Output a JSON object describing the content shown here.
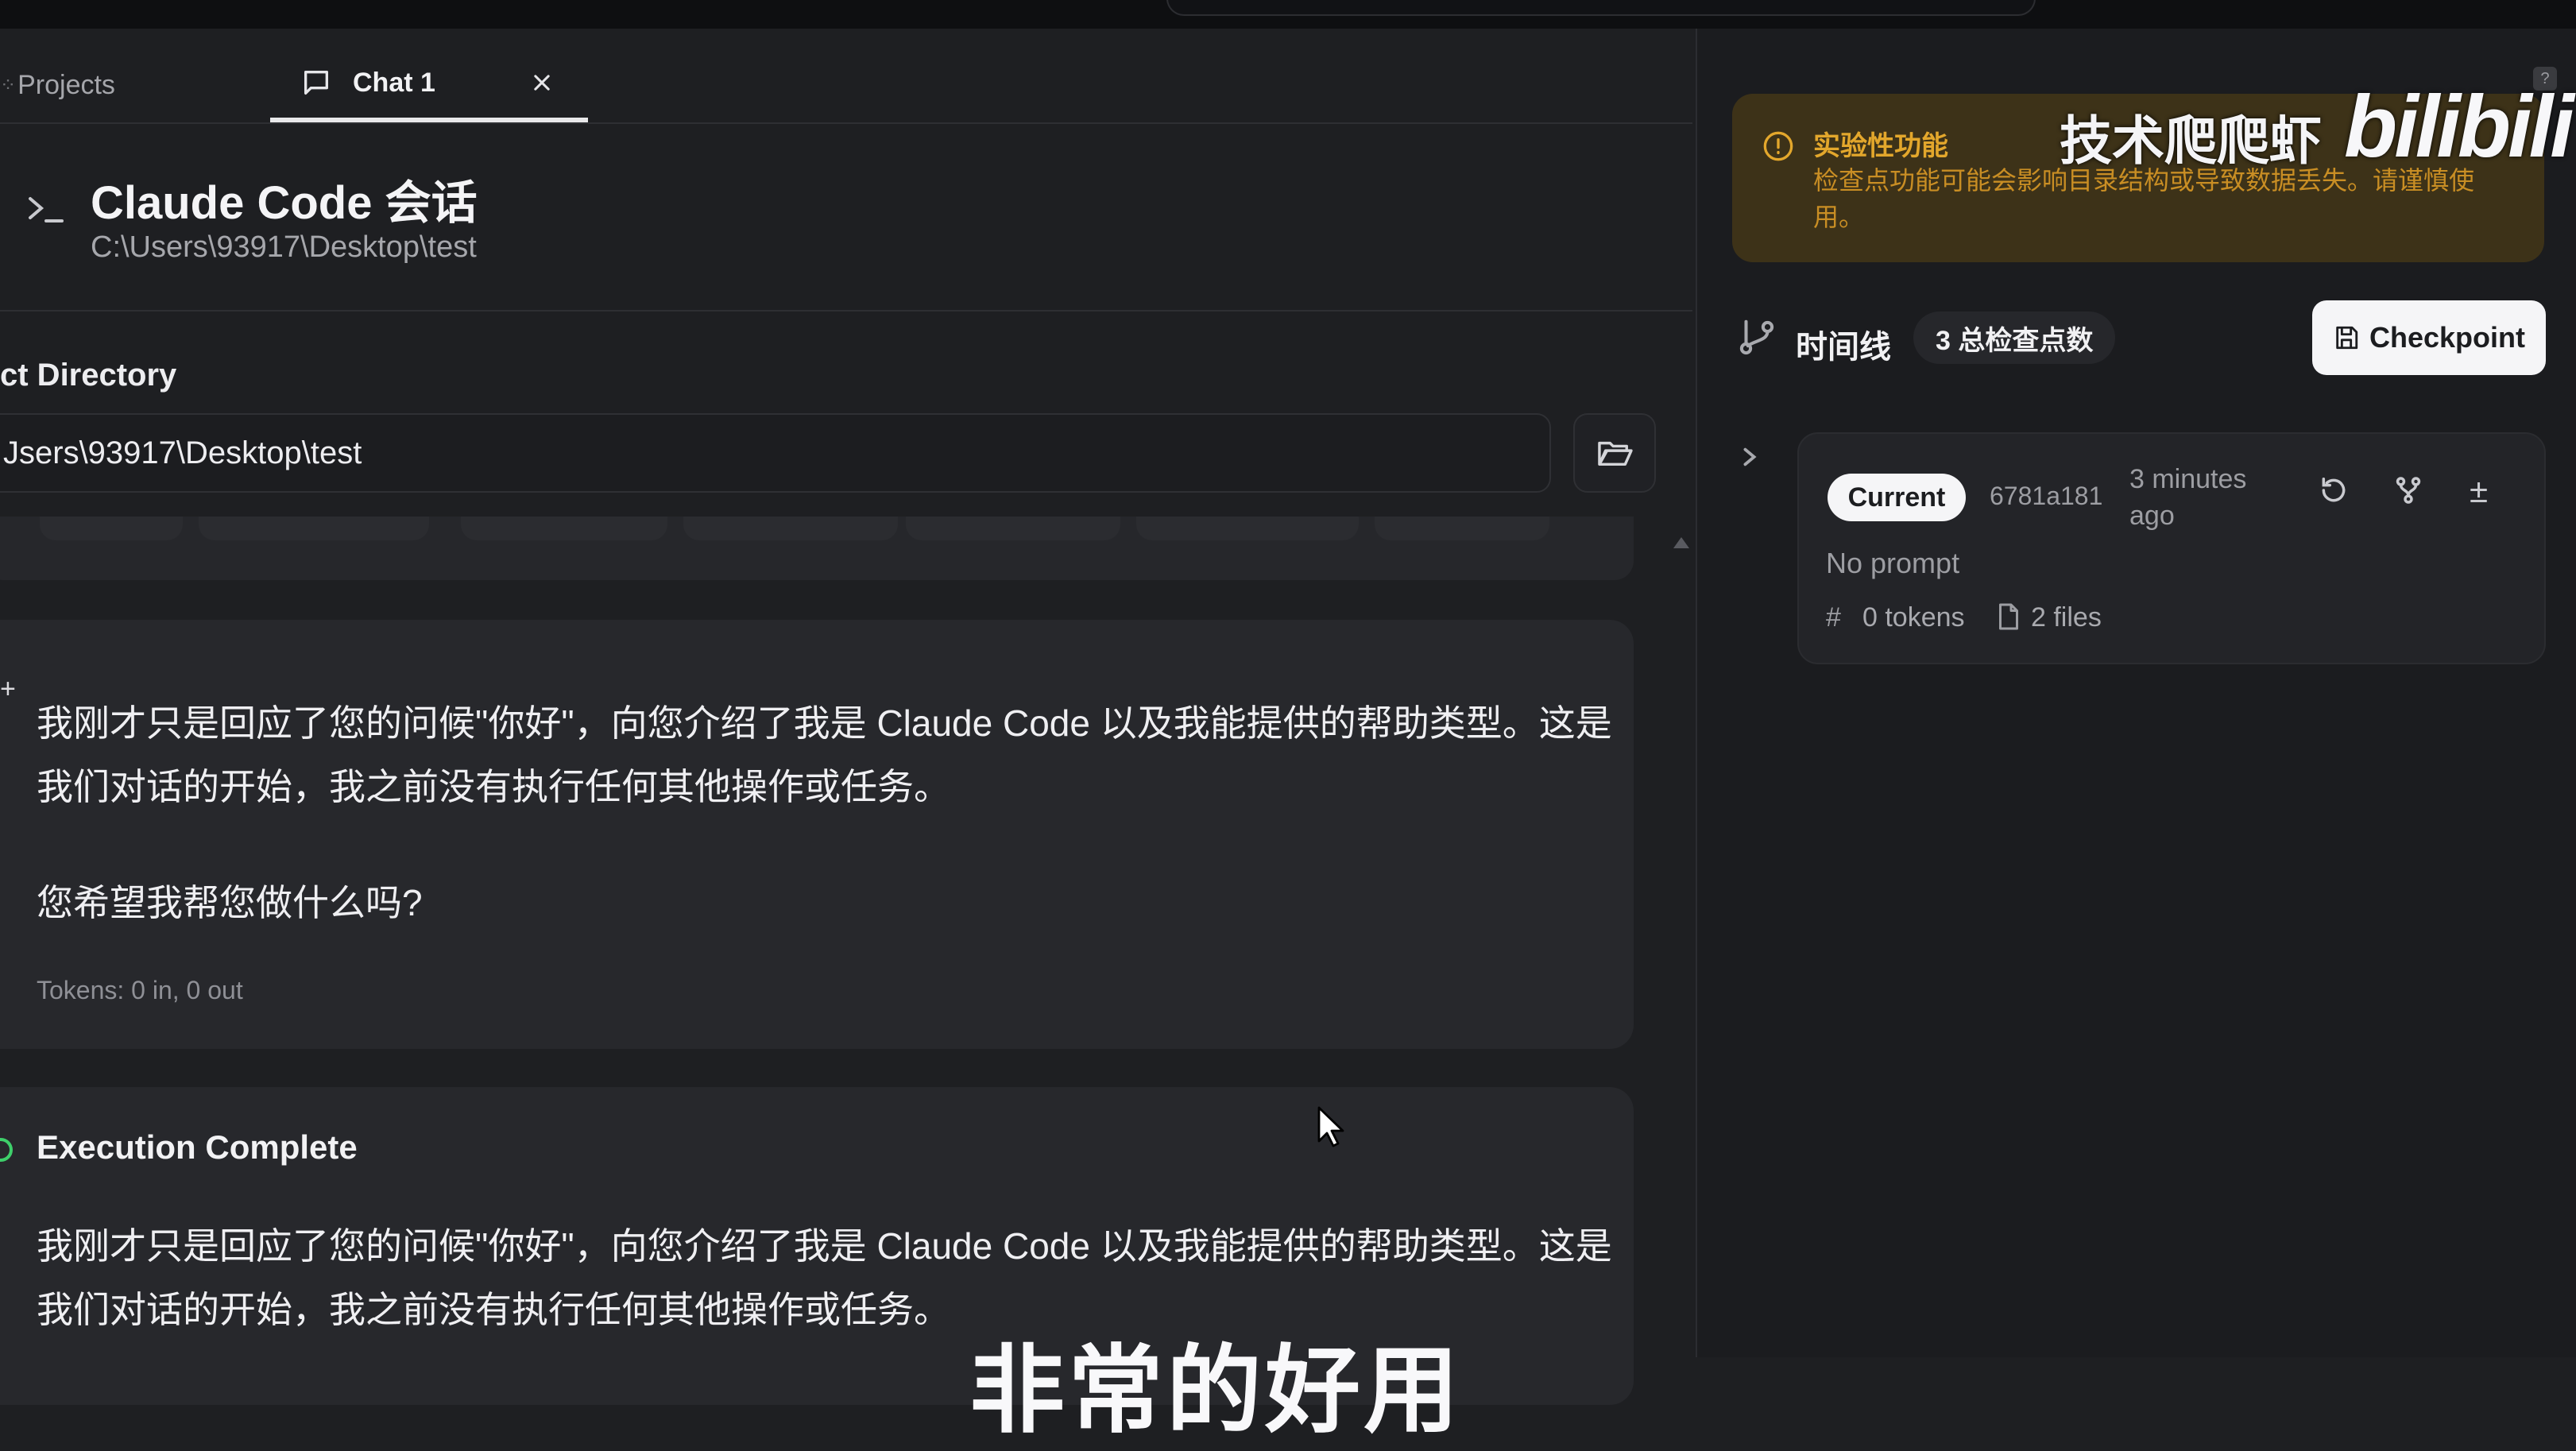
{
  "tabs": {
    "projects_label": "Projects",
    "projects_icon": "projects-icon",
    "chat_label": "Chat 1",
    "chat_icon": "message-square-icon",
    "close_icon": "close-icon"
  },
  "session": {
    "title": "Claude Code 会话",
    "path": "C:\\Users\\93917\\Desktop\\test"
  },
  "directory": {
    "label": "ct Directory",
    "value": "Jsers\\93917\\Desktop\\test"
  },
  "messages": [
    {
      "marker": "+",
      "paragraph1": "我刚才只是回应了您的问候\"你好\"，向您介绍了我是 Claude Code 以及我能提供的帮助类型。这是我们对话的开始，我之前没有执行任何其他操作或任务。",
      "paragraph2": "您希望我帮您做什么吗?",
      "tokens": "Tokens: 0 in, 0 out"
    },
    {
      "title": "Execution Complete",
      "paragraph1": "我刚才只是回应了您的问候\"你好\"，向您介绍了我是 Claude Code 以及我能提供的帮助类型。这是我们对话的开始，我之前没有执行任何其他操作或任务。"
    }
  ],
  "video_subtitle": "非常的好用",
  "warning": {
    "title": "实验性功能",
    "text": "检查点功能可能会影响目录结构或导致数据丢失。请谨慎使用。"
  },
  "watermark": {
    "text": "技术爬爬虾",
    "logo": "bilibili"
  },
  "timeline": {
    "label": "时间线",
    "count_badge": "3 总检查点数",
    "checkpoint_button": "Checkpoint",
    "checkpoint_icon": "save-icon"
  },
  "checkpoint": {
    "status": "Current",
    "hash": "6781a181",
    "time": "3 minutes ago",
    "prompt": "No prompt",
    "tokens": "0 tokens",
    "files": "2 files",
    "diff_symbol": "±"
  },
  "colors": {
    "background": "#1e1f22",
    "card": "#27282c",
    "warning_bg": "#3d3218",
    "warning_text": "#e3a72c",
    "success": "#3ecf6a"
  }
}
